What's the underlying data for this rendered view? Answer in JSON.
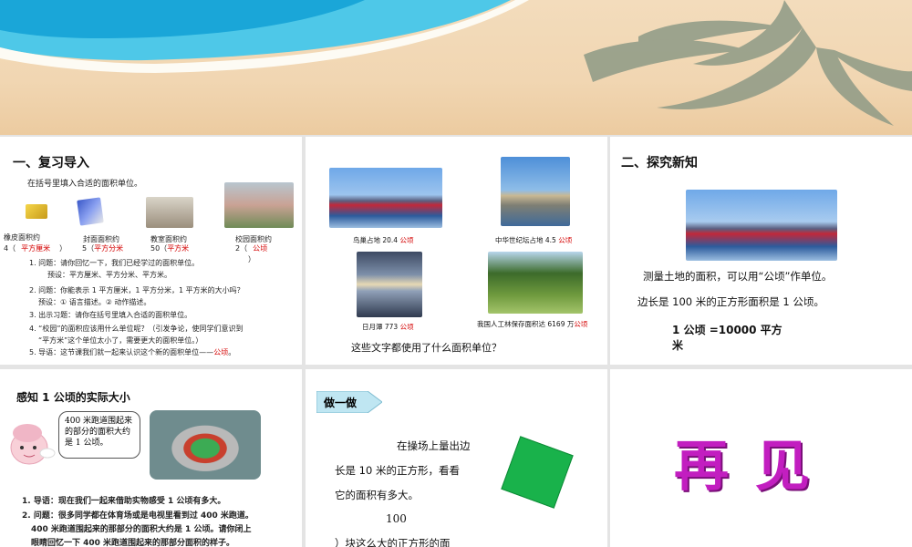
{
  "slide1": {
    "title": "一、复习导入",
    "instruction": "在括号里填入合适的面积单位。",
    "items": [
      {
        "label": "橡皮面积约",
        "value": "4（",
        "answer": "平方厘米",
        "close": "）"
      },
      {
        "label": "封面面积约",
        "value": "5（",
        "answer": "平方分米",
        "close": ""
      },
      {
        "label": "教室面积约",
        "value": "50（",
        "answer": "平方米",
        "close": ""
      },
      {
        "label": "校园面积约",
        "value": "2（",
        "answer": "公顷",
        "close": "）"
      }
    ],
    "notes": [
      "1. 问题：请你回忆一下，我们已经学过的面积单位。",
      "预设：平方厘米、平方分米、平方米。",
      "2. 问题：你能表示 1 平方厘米，1 平方分米，1 平方米的大小吗？",
      "预设：① 语言描述。② 动作描述。",
      "3. 出示习题：请你在括号里填入合适的面积单位。",
      "4. “校园”的面积应该用什么单位呢？（引发争论，使同学们意识到",
      "“平方米”这个单位太小了，需要更大的面积单位。）",
      "5. 导语：这节课我们就一起来认识这个新的面积单位——",
      "公顷",
      "。"
    ]
  },
  "slide2": {
    "captions": [
      {
        "text": "鸟巢占地 20.4 ",
        "unit": "公顷"
      },
      {
        "text": "中华世纪坛占地 4.5 ",
        "unit": "公顷"
      },
      {
        "text": "日月潭 773 ",
        "unit": "公顷"
      },
      {
        "text": "我国人工林保存面积达 6169 万",
        "unit": "公顷"
      }
    ],
    "question": "这些文字都使用了什么面积单位？"
  },
  "slide3": {
    "title": "二、探究新知",
    "line1": "测量土地的面积，可以用“公顷”作单位。",
    "line2": "边长是 100 米的正方形面积是 1 公顷。",
    "formula_a": "1 公顷 =10000 平方",
    "formula_b": "米"
  },
  "slide4": {
    "title": "感知 1 公顷的实际大小",
    "bubble": "400 米跑道围起来的部分的面积大约是 1 公顷。",
    "notes": [
      "1. 导语：现在我们一起来借助实物感受 1 公顷有多大。",
      "2. 问题：很多同学都在体育场或是电视里看到过 400 米跑道。",
      "400 米跑道围起来的那部分的面积大约是 1 公顷。请你闭上",
      "眼睛回忆一下 400 米跑道围起来的那部分面积的样子。"
    ]
  },
  "slide5": {
    "tag": "做一做",
    "lines": [
      "在操场上量出边",
      "长是 10 米的正方形，看看",
      "它的面积有多大。"
    ],
    "number": "100",
    "partial": "）块这么大的正方形的面"
  },
  "slide6": {
    "text": "再 见"
  },
  "colors": {
    "accent_red": "#d40000",
    "square_green": "#19b24b",
    "farewell_purple": "#c21ec0"
  }
}
